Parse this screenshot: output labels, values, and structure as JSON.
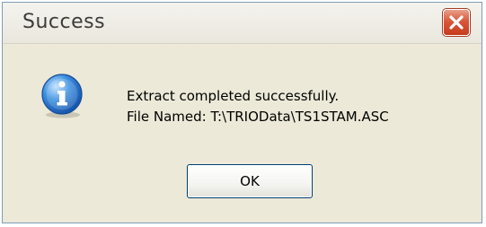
{
  "window": {
    "title": "Success"
  },
  "message": {
    "line1": "Extract completed successfully.",
    "line2": "File Named: T:\\TRIOData\\TS1STAM.ASC"
  },
  "buttons": {
    "ok_label": "OK"
  },
  "icons": {
    "close": "close-icon",
    "info": "information-icon"
  },
  "colors": {
    "dialog_background": "#ece9d8",
    "close_button": "#d8583a",
    "info_icon": "#1e6fcf"
  }
}
